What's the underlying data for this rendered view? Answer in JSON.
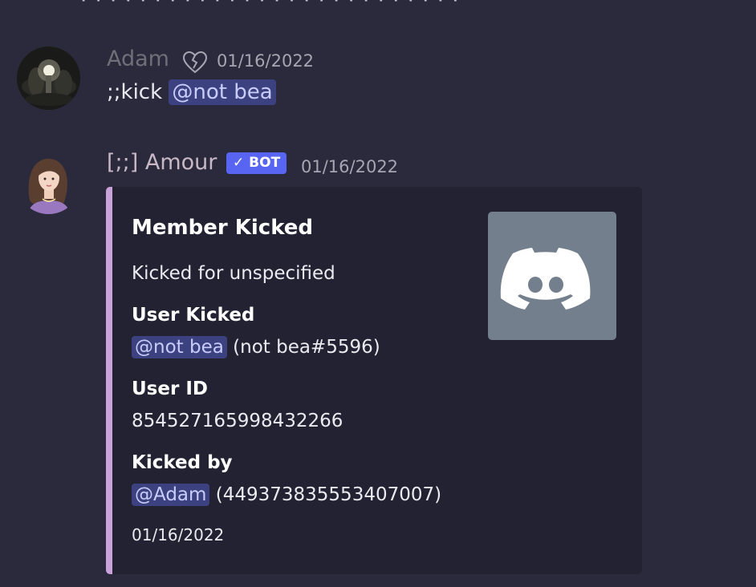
{
  "top_fragment": "· · · · · · · · · · · · · · · · · · · · · · · · · ·",
  "messages": [
    {
      "author": "Adam",
      "timestamp": "01/16/2022",
      "content_prefix": ";;kick",
      "mention": "@not bea"
    },
    {
      "author": "[;;] Amour",
      "badge": "✓ BOT",
      "timestamp": "01/16/2022"
    }
  ],
  "embed": {
    "accent_color": "#c8a2d8",
    "title": "Member Kicked",
    "description": "Kicked for unspecified",
    "fields": [
      {
        "name": "User Kicked",
        "mention": "@not bea",
        "value": "(not bea#5596)"
      },
      {
        "name": "User ID",
        "value": "854527165998432266"
      },
      {
        "name": "Kicked by",
        "mention": "@Adam",
        "value": "(449373835553407007)"
      }
    ],
    "footer": "01/16/2022",
    "thumbnail_icon": "discord-logo-icon"
  },
  "colors": {
    "background": "#2b2a3c",
    "mention_bg": "#3c4180",
    "bot_badge": "#5865f2",
    "thumbnail_bg": "#747f8d"
  }
}
